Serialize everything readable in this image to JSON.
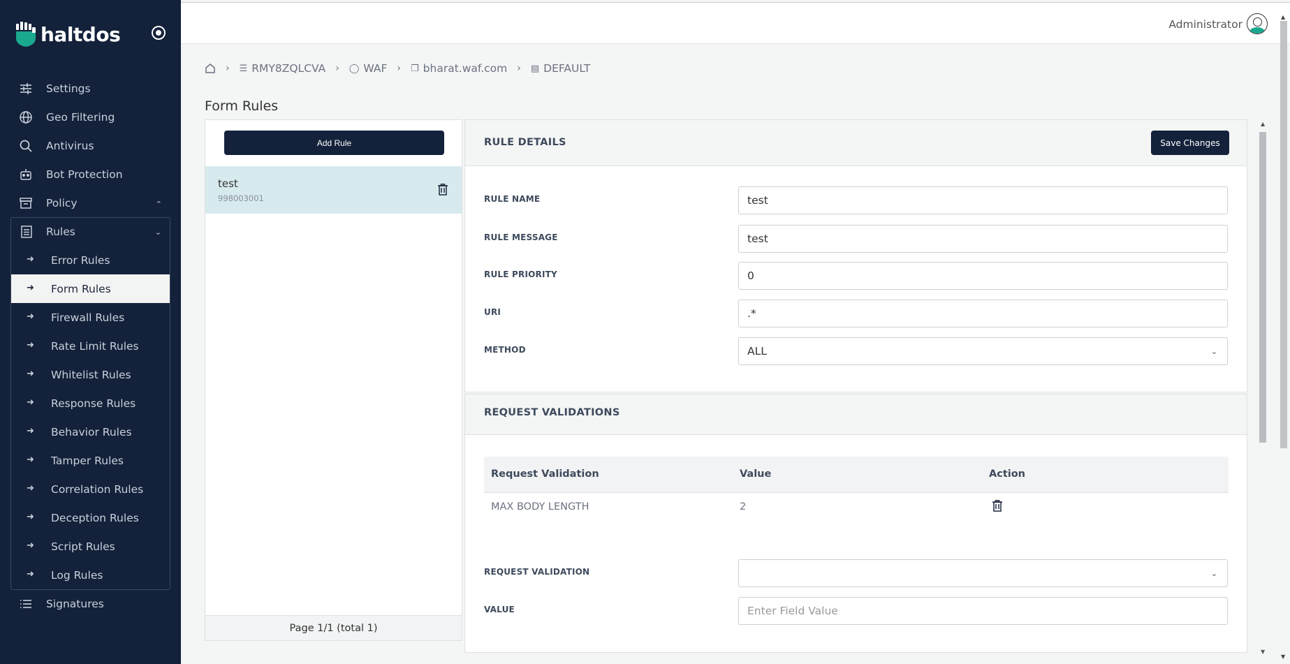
{
  "brand": {
    "name": "haltdos"
  },
  "sidebar": {
    "items": [
      {
        "label": "Settings",
        "icon": "sliders-icon"
      },
      {
        "label": "Geo Filtering",
        "icon": "globe-icon"
      },
      {
        "label": "Antivirus",
        "icon": "search-icon"
      },
      {
        "label": "Bot Protection",
        "icon": "robot-icon"
      },
      {
        "label": "Policy",
        "icon": "archive-icon"
      }
    ],
    "rules_label": "Rules",
    "sub_items": [
      "Error Rules",
      "Form Rules",
      "Firewall Rules",
      "Rate Limit Rules",
      "Whitelist Rules",
      "Response Rules",
      "Behavior Rules",
      "Tamper Rules",
      "Correlation Rules",
      "Deception Rules",
      "Script Rules",
      "Log Rules"
    ],
    "active_sub_item": "Form Rules",
    "signatures_label": "Signatures"
  },
  "topbar": {
    "user": "Administrator"
  },
  "breadcrumb": [
    "RMY8ZQLCVA",
    "WAF",
    "bharat.waf.com",
    "DEFAULT"
  ],
  "page_title": "Form Rules",
  "list": {
    "add_button": "Add Rule",
    "rules": [
      {
        "name": "test",
        "id": "998003001"
      }
    ],
    "footer": "Page 1/1 (total 1)"
  },
  "details": {
    "title": "RULE DETAILS",
    "save_button": "Save Changes",
    "fields": {
      "rule_name": {
        "label": "RULE NAME",
        "value": "test"
      },
      "rule_message": {
        "label": "RULE MESSAGE",
        "value": "test"
      },
      "rule_priority": {
        "label": "RULE PRIORITY",
        "value": "0"
      },
      "uri": {
        "label": "URI",
        "value": ".*"
      },
      "method": {
        "label": "METHOD",
        "value": "ALL"
      }
    }
  },
  "validations": {
    "title": "REQUEST VALIDATIONS",
    "columns": [
      "Request Validation",
      "Value",
      "Action"
    ],
    "rows": [
      {
        "validation": "MAX BODY LENGTH",
        "value": "2"
      }
    ],
    "form": {
      "validation_label": "REQUEST VALIDATION",
      "validation_value": "",
      "value_label": "VALUE",
      "value_placeholder": "Enter Field Value"
    }
  },
  "colors": {
    "sidebar_bg": "#13213a",
    "active_row": "#d7ebee",
    "accent": "#1aa88f"
  }
}
